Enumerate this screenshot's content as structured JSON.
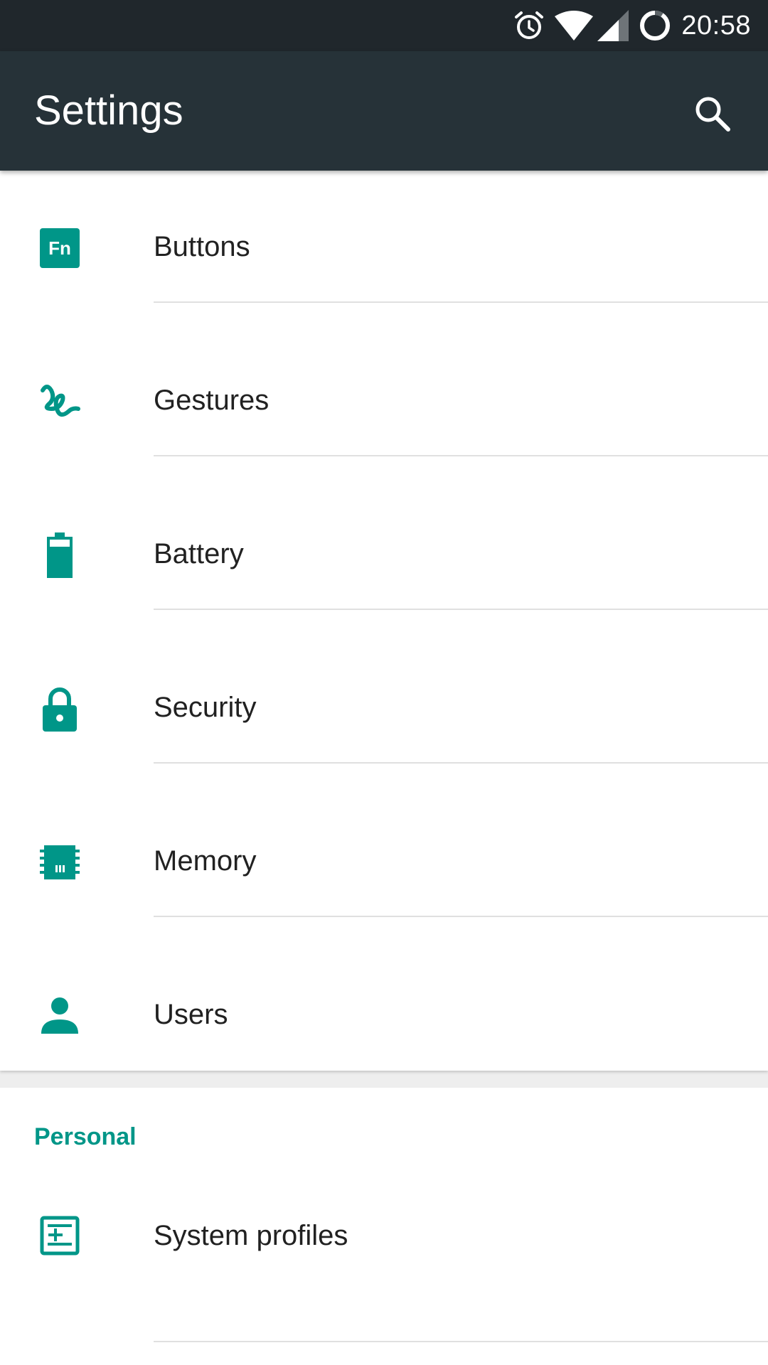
{
  "status_bar": {
    "time": "20:58",
    "icons": [
      "alarm-icon",
      "wifi-icon",
      "cell-signal-icon",
      "battery-ring-icon"
    ]
  },
  "app_bar": {
    "title": "Settings",
    "search_icon": "search-icon"
  },
  "accent_color": "#009688",
  "items": [
    {
      "label": "Buttons",
      "icon": "fn-key-icon"
    },
    {
      "label": "Gestures",
      "icon": "gesture-icon"
    },
    {
      "label": "Battery",
      "icon": "battery-icon"
    },
    {
      "label": "Security",
      "icon": "lock-icon"
    },
    {
      "label": "Memory",
      "icon": "memory-chip-icon"
    },
    {
      "label": "Users",
      "icon": "person-icon"
    }
  ],
  "personal": {
    "header": "Personal",
    "items": [
      {
        "label": "System profiles",
        "icon": "system-profiles-icon"
      }
    ]
  }
}
